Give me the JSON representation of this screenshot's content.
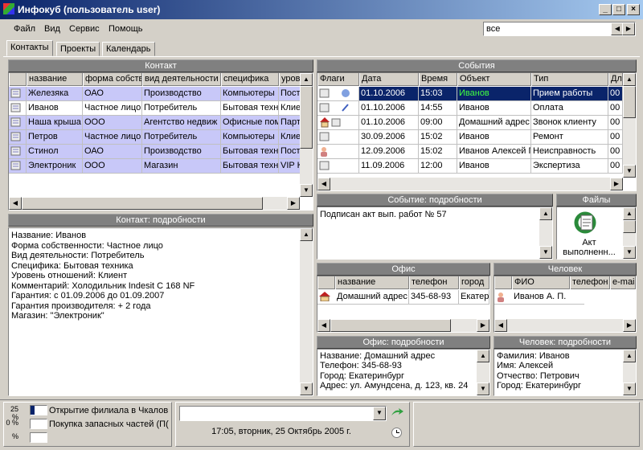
{
  "window": {
    "title": "Инфокуб (пользователь user)"
  },
  "menu": [
    "Файл",
    "Вид",
    "Сервис",
    "Помощь"
  ],
  "filter": {
    "value": "все"
  },
  "tabs": [
    "Контакты",
    "Проекты",
    "Календарь"
  ],
  "contacts": {
    "header": "Контакт",
    "columns": [
      "название",
      "форма собств",
      "вид деятельности",
      "специфика",
      "уров"
    ],
    "rows": [
      {
        "cells": [
          "Железяка",
          "ОАО",
          "Производство",
          "Компьютеры",
          "Пост"
        ],
        "style": "lav"
      },
      {
        "cells": [
          "Иванов",
          "Частное лицо",
          "Потребитель",
          "Бытовая техн",
          "Клие"
        ],
        "style": "plain"
      },
      {
        "cells": [
          "Наша крыша",
          "ООО",
          "Агентство недвиж",
          "Офисные пом",
          "Парт"
        ],
        "style": "lav"
      },
      {
        "cells": [
          "Петров",
          "Частное лицо",
          "Потребитель",
          "Компьютеры",
          "Клие"
        ],
        "style": "lav"
      },
      {
        "cells": [
          "Стинол",
          "ОАО",
          "Производство",
          "Бытовая техн",
          "Пост"
        ],
        "style": "lav"
      },
      {
        "cells": [
          "Электроник",
          "ООО",
          "Магазин",
          "Бытовая техн",
          "VIP К"
        ],
        "style": "lav"
      }
    ]
  },
  "contact_details": {
    "header": "Контакт: подробности",
    "text": "Название: Иванов\nФорма собственности: Частное лицо\nВид деятельности: Потребитель\nСпецифика: Бытовая техника\nУровень отношений: Клиент\nКомментарий: Холодильник Indesit C 168 NF\nГарантия: с 01.09.2006 до 01.09.2007\nГарантия производителя: + 2 года\nМагазин: \"Электроник\""
  },
  "events": {
    "header": "События",
    "columns": [
      "Флаги",
      "Дата",
      "Время",
      "Объект",
      "Тип",
      "Дл"
    ],
    "rows": [
      {
        "cells": [
          "",
          "01.10.2006",
          "15:03",
          "Иванов",
          "Прием работы",
          "00"
        ],
        "selected": true,
        "icon": "doc-phone-icon"
      },
      {
        "cells": [
          "",
          "01.10.2006",
          "14:55",
          "Иванов",
          "Оплата",
          "00"
        ],
        "selected": false,
        "icon": "doc-clip-icon"
      },
      {
        "cells": [
          "",
          "01.10.2006",
          "09:00",
          "Домашний адрес",
          "Звонок клиенту",
          "00"
        ],
        "selected": false,
        "icon": "house-icon"
      },
      {
        "cells": [
          "",
          "30.09.2006",
          "15:02",
          "Иванов",
          "Ремонт",
          "00"
        ],
        "selected": false,
        "icon": "doc-icon"
      },
      {
        "cells": [
          "",
          "12.09.2006",
          "15:02",
          "Иванов Алексей П",
          "Неисправность",
          "00"
        ],
        "selected": false,
        "icon": "person-icon"
      },
      {
        "cells": [
          "",
          "11.09.2006",
          "12:00",
          "Иванов",
          "Экспертиза",
          "00"
        ],
        "selected": false,
        "icon": "doc-icon"
      }
    ]
  },
  "event_details": {
    "header": "Событие: подробности",
    "text": "Подписан  акт вып. работ № 57"
  },
  "files": {
    "header": "Файлы",
    "items": [
      {
        "label": "Акт выполненн..."
      }
    ]
  },
  "office": {
    "header": "Офис",
    "columns": [
      "название",
      "телефон",
      "город"
    ],
    "rows": [
      {
        "cells": [
          "Домашний адрес",
          "345-68-93",
          "Екатер"
        ]
      }
    ]
  },
  "person": {
    "header": "Человек",
    "columns": [
      "ФИО",
      "телефон",
      "e-mail"
    ],
    "rows": [
      {
        "cells": [
          "Иванов А. П."
        ]
      }
    ]
  },
  "office_details": {
    "header": "Офис: подробности",
    "text": "Название: Домашний адрес\nТелефон: 345-68-93\nГород: Екатеринбург\nАдрес: ул. Амундсена, д. 123, кв. 24"
  },
  "person_details": {
    "header": "Человек: подробности",
    "text": "Фамилия: Иванов\nИмя: Алексей\nОтчество: Петрович\nГород: Екатеринбург"
  },
  "tasks": [
    {
      "percent": "25 %",
      "label": "Открытие филиала в Чкалов",
      "progress": 0.25
    },
    {
      "percent": "0 %",
      "label": "Покупка запасных частей (П(",
      "progress": 0
    },
    {
      "percent": "%",
      "label": "",
      "progress": 0
    }
  ],
  "status": {
    "datetime": "17:05, вторник, 25 Октябрь 2005 г.",
    "command_value": ""
  }
}
